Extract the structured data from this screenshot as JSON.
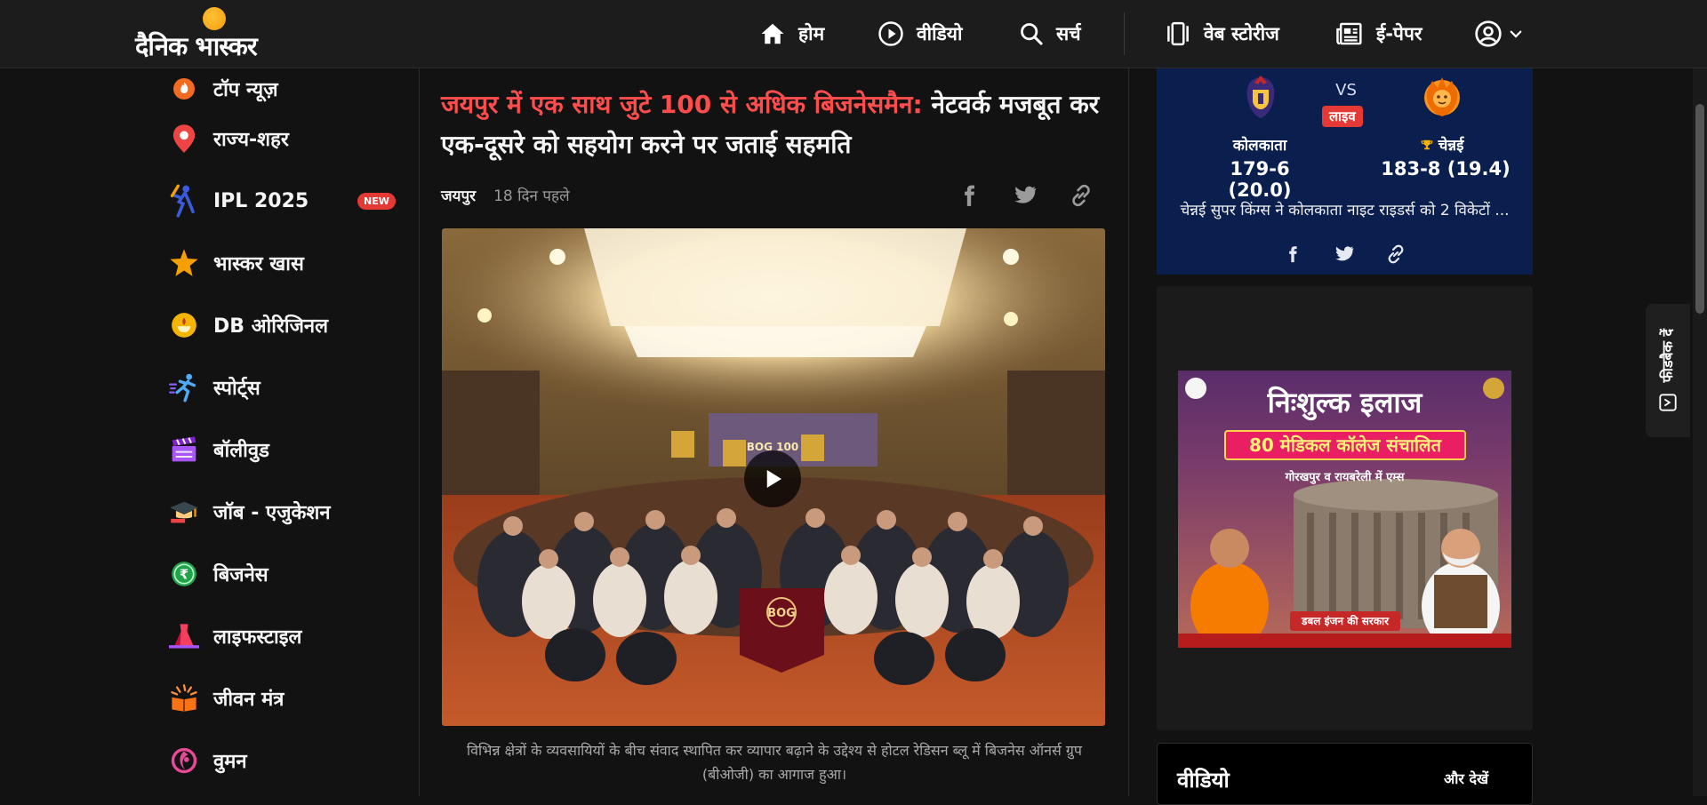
{
  "header": {
    "logo": "दैनिक भास्कर",
    "nav": [
      {
        "label": "होम",
        "icon": "home-icon"
      },
      {
        "label": "वीडियो",
        "icon": "play-circle-icon"
      },
      {
        "label": "सर्च",
        "icon": "search-icon"
      },
      {
        "label": "वेब स्टोरीज",
        "icon": "web-stories-icon"
      },
      {
        "label": "ई-पेपर",
        "icon": "newspaper-icon"
      }
    ]
  },
  "sidebar": {
    "items": [
      {
        "label": "टॉप न्यूज़",
        "icon": "flame-icon"
      },
      {
        "label": "राज्य-शहर",
        "icon": "location-pin-icon"
      },
      {
        "label": "IPL 2025",
        "icon": "cricket-player-icon",
        "badge": "NEW"
      },
      {
        "label": "भास्कर खास",
        "icon": "star-icon"
      },
      {
        "label": "DB ओरिजिनल",
        "icon": "diya-icon"
      },
      {
        "label": "स्पोर्ट्स",
        "icon": "runner-icon"
      },
      {
        "label": "बॉलीवुड",
        "icon": "clapperboard-icon"
      },
      {
        "label": "जॉब - एजुकेशन",
        "icon": "graduation-cap-icon"
      },
      {
        "label": "बिजनेस",
        "icon": "rupee-coin-icon"
      },
      {
        "label": "लाइफस्टाइल",
        "icon": "dress-icon"
      },
      {
        "label": "जीवन मंत्र",
        "icon": "book-icon"
      },
      {
        "label": "वुमन",
        "icon": "woman-icon"
      }
    ]
  },
  "article": {
    "headline_red": "जयपुर में एक साथ जुटे 100 से अधिक बिजनेसमैन:",
    "headline_rest": " नेटवर्क मजबूत कर एक-दूसरे को सहयोग करने पर जताई सहमति",
    "city": "जयपुर",
    "time": "18 दिन पहले",
    "caption": "विभिन्न क्षेत्रों के व्यवसायियों के बीच संवाद स्थापित कर व्यापार बढ़ाने के उद्देश्य से होटल रेडिसन ब्लू में बिजनेस ऑनर्स ग्रुप (बीओजी) का आगाज हुआ।",
    "photo_banner": "BOG 100",
    "photo_flag": "BOG"
  },
  "scorecard": {
    "vs": "VS",
    "live": "लाइव",
    "team1": {
      "name": "कोलकाता",
      "score": "179-6 (20.0)"
    },
    "team2": {
      "name": "चेन्नई",
      "score": "183-8 (19.4)"
    },
    "result": "चेन्नई सुपर किंग्स ने कोलकाता नाइट राइडर्स को 2 विकेटों ..."
  },
  "ad": {
    "title": "निःशुल्क इलाज",
    "pill": "80 मेडिकल कॉलेज संचालित",
    "sub": "गोरखपुर व रायबरेली में एम्स",
    "tag": "डबल इंजन की सरकार"
  },
  "videos": {
    "title": "वीडियो",
    "more": "और देखें"
  },
  "feedback": {
    "label": "फीडबैक दें"
  },
  "colors": {
    "headline_red": "#ff4d4d",
    "score_bg": "#0b1f4f",
    "live_red": "#e53935"
  }
}
